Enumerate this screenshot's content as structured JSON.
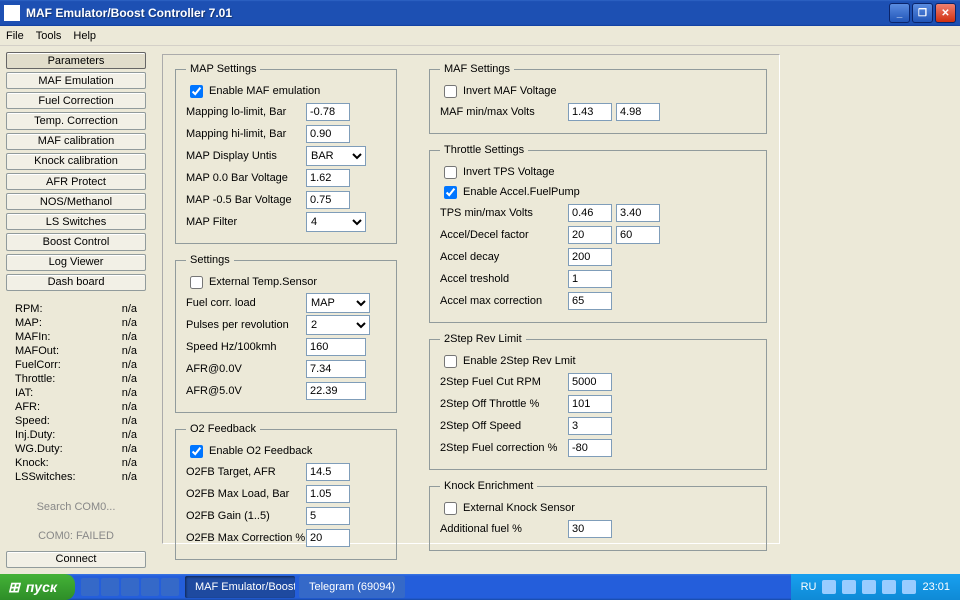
{
  "title": "MAF Emulator/Boost Controller 7.01",
  "menu": [
    "File",
    "Tools",
    "Help"
  ],
  "sidebar": [
    "Parameters",
    "MAF Emulation",
    "Fuel Correction",
    "Temp. Correction",
    "MAF calibration",
    "Knock calibration",
    "AFR Protect",
    "NOS/Methanol",
    "LS Switches",
    "Boost Control",
    "Log Viewer",
    "Dash board"
  ],
  "stats": [
    {
      "k": "RPM:",
      "v": "n/a"
    },
    {
      "k": "MAP:",
      "v": "n/a"
    },
    {
      "k": "MAFIn:",
      "v": "n/a"
    },
    {
      "k": "MAFOut:",
      "v": "n/a"
    },
    {
      "k": "FuelCorr:",
      "v": "n/a"
    },
    {
      "k": "Throttle:",
      "v": "n/a"
    },
    {
      "k": "IAT:",
      "v": "n/a"
    },
    {
      "k": "AFR:",
      "v": "n/a"
    },
    {
      "k": "Speed:",
      "v": "n/a"
    },
    {
      "k": "Inj.Duty:",
      "v": "n/a"
    },
    {
      "k": "WG.Duty:",
      "v": "n/a"
    },
    {
      "k": "Knock:",
      "v": "n/a"
    },
    {
      "k": "LSSwitches:",
      "v": "n/a"
    }
  ],
  "search": "Search COM0...",
  "com": "COM0: FAILED",
  "connect": "Connect",
  "map_settings": {
    "legend": "MAP Settings",
    "enable": "Enable MAF emulation",
    "enable_v": true,
    "lo_l": "Mapping lo-limit, Bar",
    "lo_v": "-0.78",
    "hi_l": "Mapping hi-limit, Bar",
    "hi_v": "0.90",
    "units_l": "MAP Display Untis",
    "units_v": "BAR",
    "v0_l": "MAP  0.0 Bar Voltage",
    "v0_v": "1.62",
    "v05_l": "MAP -0.5 Bar Voltage",
    "v05_v": "0.75",
    "filter_l": "MAP Filter",
    "filter_v": "4"
  },
  "settings": {
    "legend": "Settings",
    "ext_l": "External Temp.Sensor",
    "ext_v": false,
    "load_l": "Fuel corr. load",
    "load_v": "MAP",
    "ppr_l": "Pulses per revolution",
    "ppr_v": "2",
    "speed_l": "Speed Hz/100kmh",
    "speed_v": "160",
    "afr0_l": "AFR@0.0V",
    "afr0_v": "7.34",
    "afr5_l": "AFR@5.0V",
    "afr5_v": "22.39"
  },
  "o2": {
    "legend": "O2 Feedback",
    "en_l": "Enable O2 Feedback",
    "en_v": true,
    "tgt_l": "O2FB Target, AFR",
    "tgt_v": "14.5",
    "max_l": "O2FB Max Load, Bar",
    "max_v": "1.05",
    "gain_l": "O2FB Gain (1..5)",
    "gain_v": "5",
    "corr_l": "O2FB Max Correction %",
    "corr_v": "20"
  },
  "maf": {
    "legend": "MAF Settings",
    "inv_l": "Invert MAF Voltage",
    "inv_v": false,
    "mm_l": "MAF min/max Volts",
    "min_v": "1.43",
    "max_v": "4.98"
  },
  "throttle": {
    "legend": "Throttle Settings",
    "inv_l": "Invert TPS Voltage",
    "inv_v": false,
    "fp_l": "Enable Accel.FuelPump",
    "fp_v": true,
    "mm_l": "TPS min/max Volts",
    "min_v": "0.46",
    "max_v": "3.40",
    "ad_l": "Accel/Decel factor",
    "a_v": "20",
    "d_v": "60",
    "decay_l": "Accel decay",
    "decay_v": "200",
    "tres_l": "Accel treshold",
    "tres_v": "1",
    "max_l": "Accel max correction",
    "max_c": "65"
  },
  "rev": {
    "legend": "2Step Rev Limit",
    "en_l": "Enable 2Step Rev Lmit",
    "en_v": false,
    "rpm_l": "2Step Fuel Cut RPM",
    "rpm_v": "5000",
    "thr_l": "2Step Off Throttle %",
    "thr_v": "101",
    "spd_l": "2Step Off Speed",
    "spd_v": "3",
    "cor_l": "2Step Fuel correction %",
    "cor_v": "-80"
  },
  "knock": {
    "legend": "Knock Enrichment",
    "ext_l": "External Knock Sensor",
    "ext_v": false,
    "add_l": "Additional fuel %",
    "add_v": "30"
  },
  "taskbar": {
    "start": "пуск",
    "apps": [
      "MAF Emulator/Boost ...",
      "Telegram (69094)"
    ],
    "lang": "RU",
    "time": "23:01"
  }
}
